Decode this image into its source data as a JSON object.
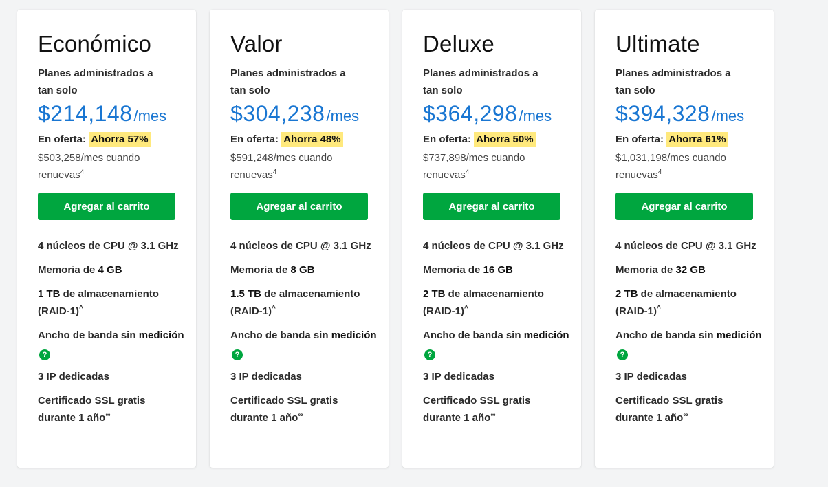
{
  "colors": {
    "accent_price": "#1976d2",
    "button_green": "#00a63f",
    "badge_yellow": "#ffe97d",
    "page_bg": "#f3f4f5"
  },
  "plans": [
    {
      "name": "Económico",
      "subtitle": "Planes administrados a tan solo",
      "price": "$214,148",
      "period": "/mes",
      "offer_label": "En oferta:",
      "badge": "Ahorra 57%",
      "renew_text": "$503,258/mes cuando renuevas",
      "renew_sup": "4",
      "button": "Agregar al carrito",
      "features": {
        "cpu": "4 núcleos de CPU @ 3.1 GHz",
        "memory_prefix": "Memoria de ",
        "memory_value": "4 GB",
        "storage_value": "1 TB",
        "storage_suffix": " de almacenamiento (RAID-1)",
        "storage_sup": "^",
        "bandwidth_prefix": "Ancho de banda sin ",
        "bandwidth_bold": "medición",
        "ips": "3 IP dedicadas",
        "ssl_text": "Certificado SSL gratis durante 1 año",
        "ssl_sup": "∞"
      }
    },
    {
      "name": "Valor",
      "subtitle": "Planes administrados a tan solo",
      "price": "$304,238",
      "period": "/mes",
      "offer_label": "En oferta:",
      "badge": "Ahorra 48%",
      "renew_text": "$591,248/mes cuando renuevas",
      "renew_sup": "4",
      "button": "Agregar al carrito",
      "features": {
        "cpu": "4 núcleos de CPU @ 3.1 GHz",
        "memory_prefix": "Memoria de ",
        "memory_value": "8 GB",
        "storage_value": "1.5 TB",
        "storage_suffix": " de almacenamiento (RAID-1)",
        "storage_sup": "^",
        "bandwidth_prefix": "Ancho de banda sin ",
        "bandwidth_bold": "medición",
        "ips": "3 IP dedicadas",
        "ssl_text": "Certificado SSL gratis durante 1 año",
        "ssl_sup": "∞"
      }
    },
    {
      "name": "Deluxe",
      "subtitle": "Planes administrados a tan solo",
      "price": "$364,298",
      "period": "/mes",
      "offer_label": "En oferta:",
      "badge": "Ahorra 50%",
      "renew_text": "$737,898/mes cuando renuevas",
      "renew_sup": "4",
      "button": "Agregar al carrito",
      "features": {
        "cpu": "4 núcleos de CPU @ 3.1 GHz",
        "memory_prefix": "Memoria de ",
        "memory_value": "16 GB",
        "storage_value": "2 TB",
        "storage_suffix": " de almacenamiento (RAID-1)",
        "storage_sup": "^",
        "bandwidth_prefix": "Ancho de banda sin ",
        "bandwidth_bold": "medición",
        "ips": "3 IP dedicadas",
        "ssl_text": "Certificado SSL gratis durante 1 año",
        "ssl_sup": "∞"
      }
    },
    {
      "name": "Ultimate",
      "subtitle": "Planes administrados a tan solo",
      "price": "$394,328",
      "period": "/mes",
      "offer_label": "En oferta:",
      "badge": "Ahorra 61%",
      "renew_text": "$1,031,198/mes cuando renuevas",
      "renew_sup": "4",
      "button": "Agregar al carrito",
      "features": {
        "cpu": "4 núcleos de CPU @ 3.1 GHz",
        "memory_prefix": "Memoria de ",
        "memory_value": "32 GB",
        "storage_value": "2 TB",
        "storage_suffix": " de almacenamiento (RAID-1)",
        "storage_sup": "^",
        "bandwidth_prefix": "Ancho de banda sin ",
        "bandwidth_bold": "medición",
        "ips": "3 IP dedicadas",
        "ssl_text": "Certificado SSL gratis durante 1 año",
        "ssl_sup": "∞"
      }
    }
  ],
  "help_icon_glyph": "?"
}
